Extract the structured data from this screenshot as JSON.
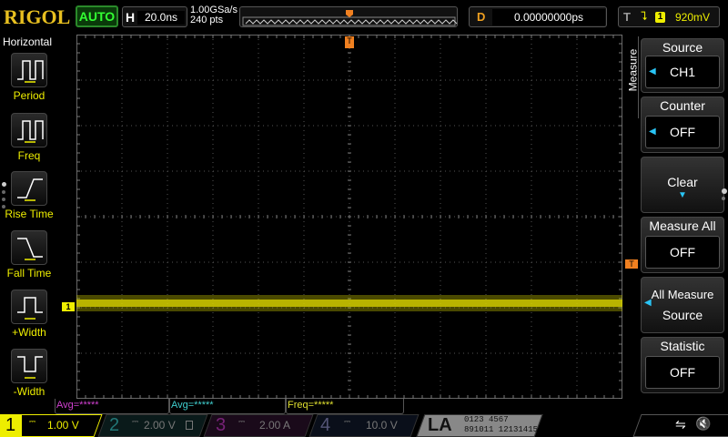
{
  "header": {
    "logo": "RIGOL",
    "run_mode": "AUTO",
    "h_label": "H",
    "timebase": "20.0ns",
    "sample_rate": "1.00GSa/s",
    "memory_depth": "240 pts",
    "d_label": "D",
    "delay": "0.00000000ps",
    "t_label": "T",
    "trigger_edge": "falling",
    "trigger_source": "1",
    "trigger_level": "920mV"
  },
  "left_menu": {
    "title": "Horizontal",
    "items": [
      {
        "label": "Period",
        "icon": "period-icon"
      },
      {
        "label": "Freq",
        "icon": "freq-icon"
      },
      {
        "label": "Rise Time",
        "icon": "rise-time-icon"
      },
      {
        "label": "Fall Time",
        "icon": "fall-time-icon"
      },
      {
        "label": "+Width",
        "icon": "pos-width-icon"
      },
      {
        "label": "-Width",
        "icon": "neg-width-icon"
      }
    ]
  },
  "right_menu": {
    "tab": "Measure",
    "source": {
      "title": "Source",
      "value": "CH1"
    },
    "counter": {
      "title": "Counter",
      "value": "OFF"
    },
    "clear": {
      "title": "Clear"
    },
    "measure_all": {
      "title": "Measure All",
      "value": "OFF"
    },
    "all_measure_source": {
      "line1": "All Measure",
      "line2": "Source"
    },
    "statistic": {
      "title": "Statistic",
      "value": "OFF"
    }
  },
  "screen": {
    "ch1_marker": "1",
    "trigger_marker": "T",
    "trace_color": "#d4d000"
  },
  "measurements": [
    {
      "text": "Avg=*****",
      "color": "#d040d0"
    },
    {
      "text": "Avg=*****",
      "color": "#40d0d0"
    },
    {
      "text": "Freq=*****",
      "color": "#e0e030"
    }
  ],
  "channels": [
    {
      "num": "1",
      "coupling": "⎓",
      "scale": "1.00 V",
      "color": "#f0f000"
    },
    {
      "num": "2",
      "coupling": "⎓",
      "scale": "2.00 V",
      "color": "#20a0a0"
    },
    {
      "num": "3",
      "coupling": "⎓",
      "scale": "2.00 A",
      "color": "#c030c0"
    },
    {
      "num": "4",
      "coupling": "⎓",
      "scale": "10.0 V",
      "color": "#3070d0"
    }
  ],
  "la": {
    "label": "LA",
    "bits_row1": "0123 4567",
    "bits_row2": "891011 12131415"
  },
  "status": {
    "usb": "⇋",
    "sound": "🔇"
  }
}
